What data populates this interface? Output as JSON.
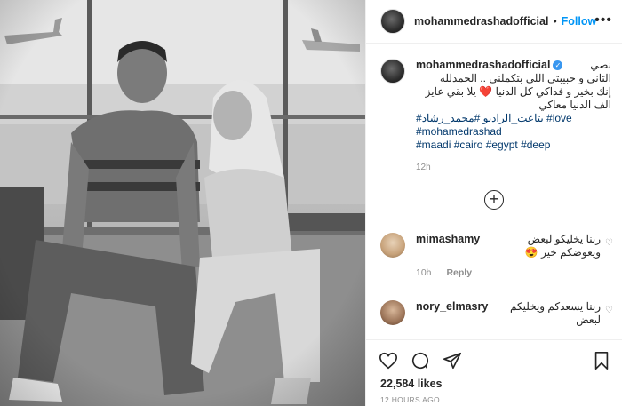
{
  "post": {
    "username": "mohammedrashadofficial",
    "follow_label": "Follow",
    "separator": "•",
    "more_label": "•••",
    "verified_mark": "✓"
  },
  "caption": {
    "username": "mohammedrashadofficial",
    "line1": "نصي",
    "line2": "التاني و حبيبتي اللي بتكملني .. الحمدلله",
    "line3": "إنك بخير و فداكي كل الدنيا",
    "heart": "❤️",
    "line3b": "يلا بقي عايز",
    "line4": "الف الدنيا معاكي",
    "tags_line1": "#بتاعت_الراديو #محمد_رشاد #love",
    "tags_line2": "#mohamedrashad",
    "tags_line3": "#maadi #cairo #egypt #deep",
    "time": "12h"
  },
  "add_comment_label": "+",
  "comments": [
    {
      "username": "mimashamy",
      "text1": "ربنا يخليكو لبعض",
      "text2": "ويعوضكم خير 😍",
      "time": "10h",
      "reply": "Reply",
      "heart": "♡"
    },
    {
      "username": "nory_elmasry",
      "text1": "ربنا يسعدكم ويخليكم",
      "text2": "لبعض",
      "heart": "♡"
    }
  ],
  "stats": {
    "likes": "22,584 likes",
    "ago": "12 HOURS AGO"
  },
  "icons": [
    "heart-icon",
    "comment-icon",
    "share-icon",
    "bookmark-icon"
  ]
}
